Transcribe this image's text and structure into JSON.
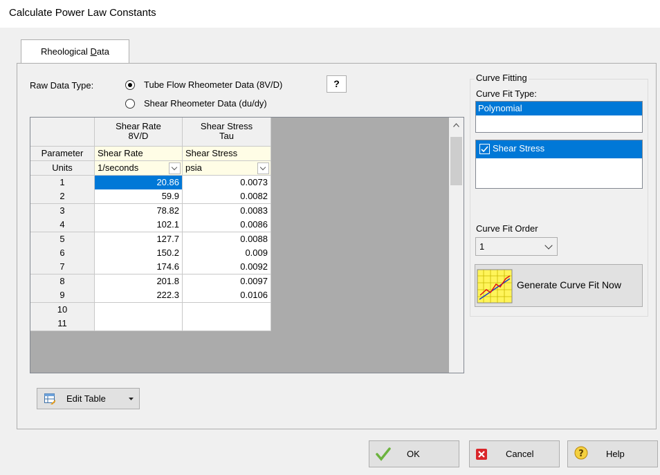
{
  "window": {
    "title": "Calculate Power Law Constants"
  },
  "tabs": [
    {
      "label_pre": "Rheological ",
      "label_ul": "D",
      "label_post": "ata"
    }
  ],
  "raw_data_type": {
    "label": "Raw Data Type:",
    "options": [
      "Tube Flow Rheometer Data (8V/D)",
      "Shear Rheometer Data (du/dy)"
    ],
    "selected_index": 0,
    "help_label": "?"
  },
  "grid": {
    "col_headers": [
      {
        "line1": "Shear Rate",
        "line2": "8V/D"
      },
      {
        "line1": "Shear Stress",
        "line2": "Tau"
      }
    ],
    "parameter_label": "Parameter",
    "units_label": "Units",
    "parameters": [
      "Shear Rate",
      "Shear Stress"
    ],
    "units": [
      "1/seconds",
      "psia"
    ],
    "rows": [
      {
        "n": "1",
        "rate": "20.86",
        "stress": "0.0073"
      },
      {
        "n": "2",
        "rate": "59.9",
        "stress": "0.0082"
      },
      {
        "n": "3",
        "rate": "78.82",
        "stress": "0.0083"
      },
      {
        "n": "4",
        "rate": "102.1",
        "stress": "0.0086"
      },
      {
        "n": "5",
        "rate": "127.7",
        "stress": "0.0088"
      },
      {
        "n": "6",
        "rate": "150.2",
        "stress": "0.009"
      },
      {
        "n": "7",
        "rate": "174.6",
        "stress": "0.0092"
      },
      {
        "n": "8",
        "rate": "201.8",
        "stress": "0.0097"
      },
      {
        "n": "9",
        "rate": "222.3",
        "stress": "0.0106"
      },
      {
        "n": "10",
        "rate": "",
        "stress": ""
      },
      {
        "n": "11",
        "rate": "",
        "stress": ""
      }
    ]
  },
  "curve_fitting": {
    "group_label": "Curve Fitting",
    "fit_type_label": "Curve Fit Type:",
    "fit_type_selected": "Polynomial",
    "series": [
      {
        "label": "Shear Stress",
        "checked": true
      }
    ],
    "order_label": "Curve Fit Order",
    "order_value": "1",
    "generate_label": "Generate Curve Fit Now"
  },
  "edit_table_label": "Edit Table",
  "buttons": {
    "ok": "OK",
    "cancel": "Cancel",
    "help": "Help"
  },
  "colors": {
    "selection": "#0078d7",
    "param_row": "#fffde6",
    "grid_empty": "#ababab"
  }
}
